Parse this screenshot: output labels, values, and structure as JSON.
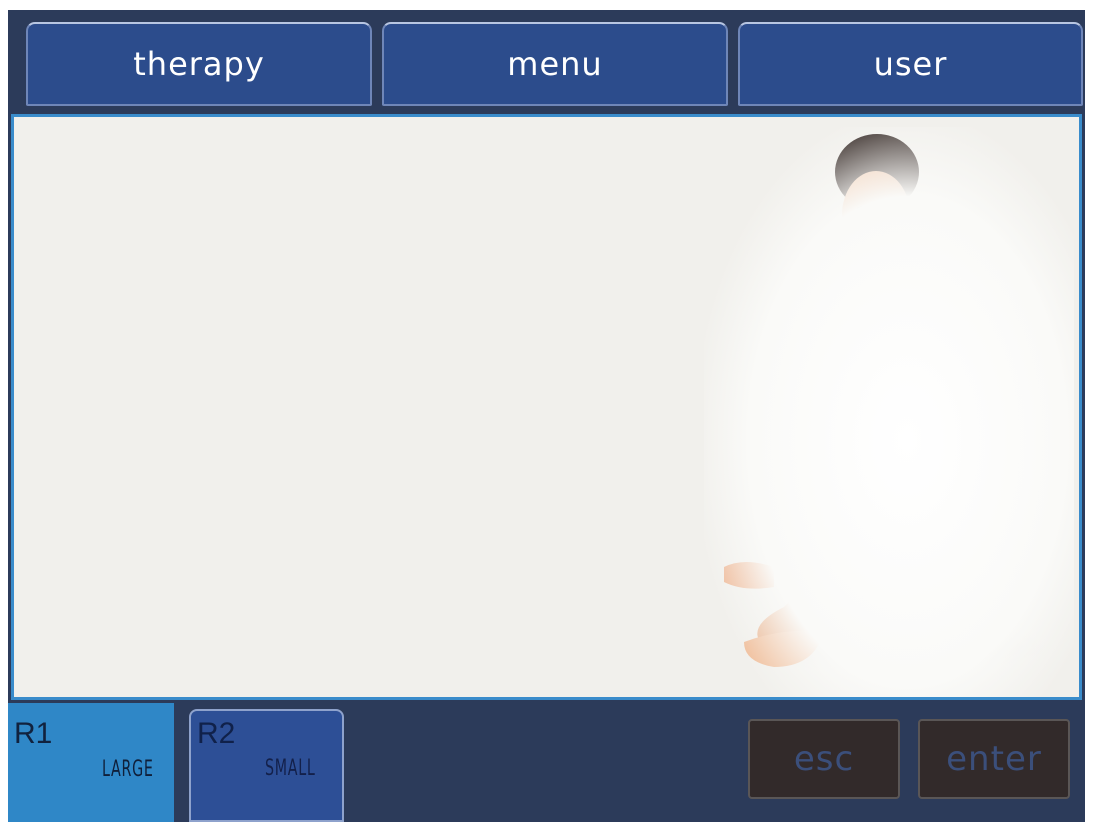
{
  "tabs": [
    {
      "label": "therapy"
    },
    {
      "label": "menu"
    },
    {
      "label": "user"
    }
  ],
  "handpieces": [
    {
      "name": "R1",
      "size": "LARGE"
    },
    {
      "name": "R2",
      "size": "SMALL"
    }
  ],
  "buttons": {
    "esc_label": "esc",
    "enter_label": "enter"
  },
  "colors": {
    "tab_blue": "#2c4c8c",
    "frame_blue": "#3a8ccb",
    "active_handpiece": "#2f87c7",
    "background": "#2c3b5a",
    "content_bg": "#f1f0ec"
  }
}
